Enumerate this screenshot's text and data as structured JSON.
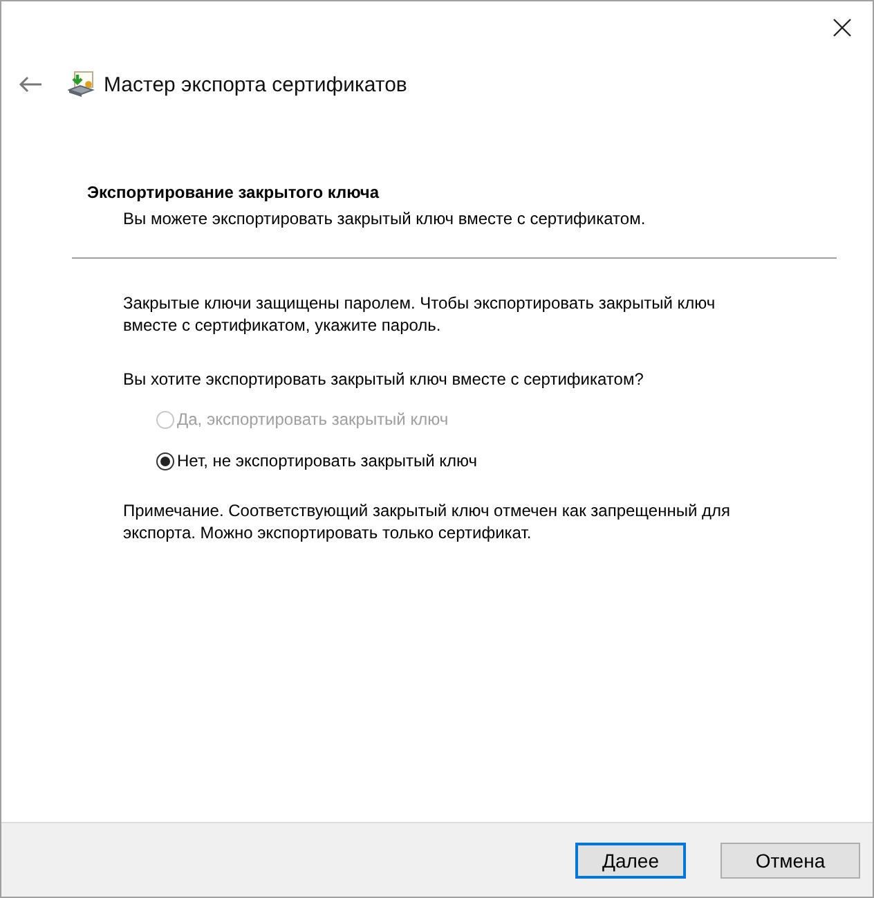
{
  "window": {
    "title": "Мастер экспорта сертификатов"
  },
  "section": {
    "heading": "Экспортирование закрытого ключа",
    "subtitle": "Вы можете экспортировать закрытый ключ вместе с сертификатом."
  },
  "intro": "Закрытые ключи защищены паролем. Чтобы экспортировать закрытый ключ вместе с сертификатом, укажите пароль.",
  "question": "Вы хотите экспортировать закрытый ключ вместе с сертификатом?",
  "options": [
    {
      "label": "Да, экспортировать закрытый ключ",
      "selected": false,
      "disabled": true
    },
    {
      "label": "Нет, не экспортировать закрытый ключ",
      "selected": true,
      "disabled": false
    }
  ],
  "note": "Примечание. Соответствующий закрытый ключ отмечен как запрещенный для экспорта. Можно экспортировать только сертификат.",
  "buttons": [
    {
      "label": "Далее",
      "default": true
    },
    {
      "label": "Отмена",
      "default": false
    }
  ]
}
